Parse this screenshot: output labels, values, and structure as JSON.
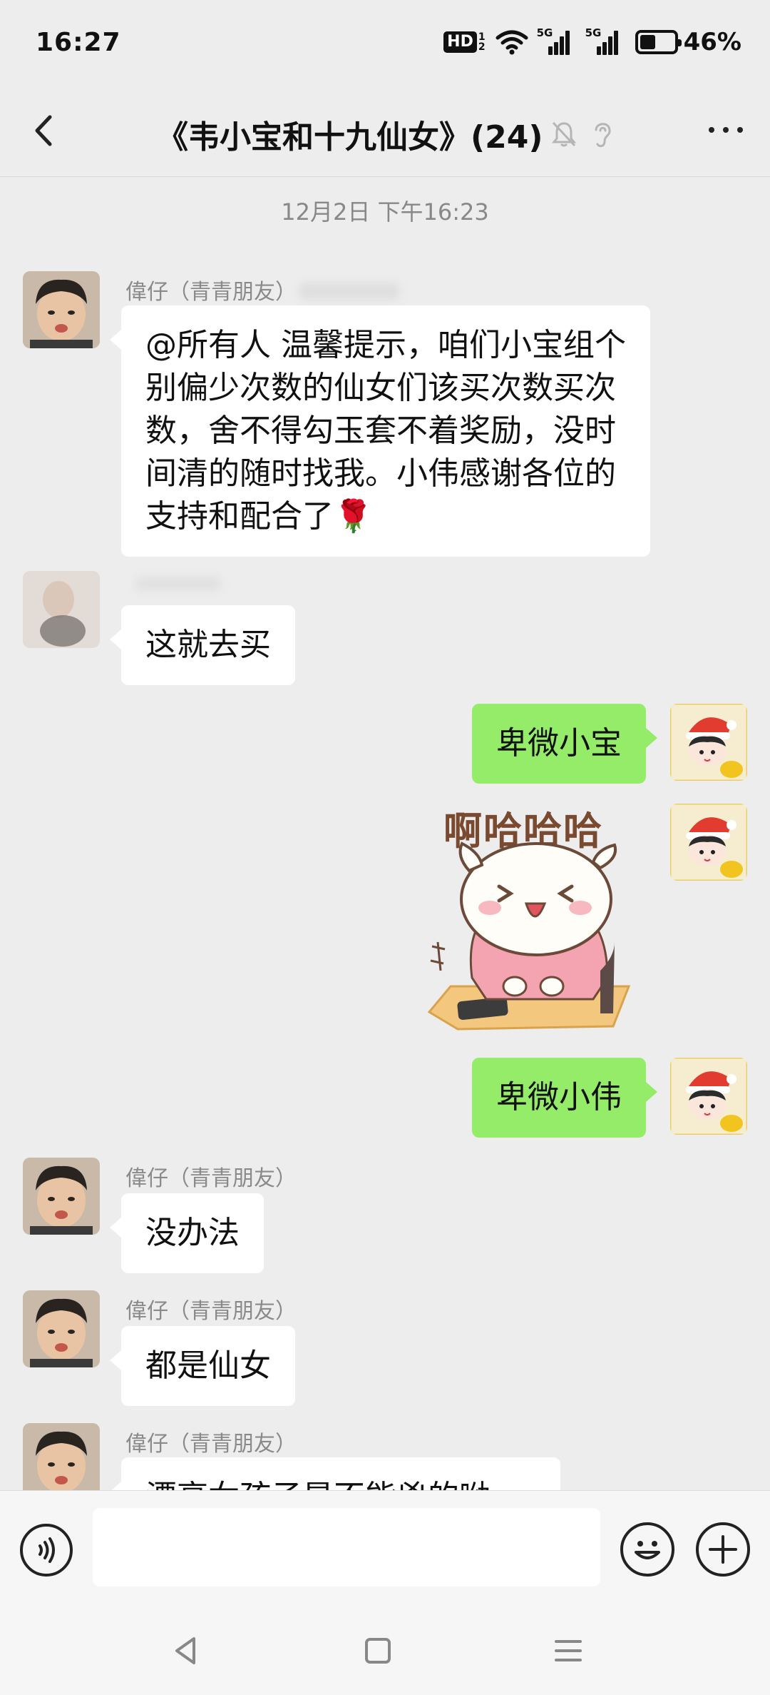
{
  "status": {
    "time": "16:27",
    "hd_label": "HD",
    "hd_sub_1": "1",
    "hd_sub_2": "2",
    "sig1_label": "5G",
    "sig2_label": "5G",
    "battery_text": "46%",
    "battery_level": 0.46
  },
  "header": {
    "title": "《韦小宝和十九仙女》(24)"
  },
  "timestamp": "12月2日 下午16:23",
  "messages": [
    {
      "sender": "偉仔（青青朋友）",
      "text": "@所有人  温馨提示，咱们小宝组个别偏少次数的仙女们该买次数买次数，舍不得勾玉套不着奖励，没时间清的随时找我。小伟感谢各位的支持和配合了🌹",
      "side": "left"
    },
    {
      "sender": "",
      "text": "这就去买",
      "side": "left"
    },
    {
      "text": "卑微小宝",
      "side": "right"
    },
    {
      "sticker_text": "啊哈哈哈",
      "side": "right"
    },
    {
      "text": "卑微小伟",
      "side": "right"
    },
    {
      "sender": "偉仔（青青朋友）",
      "text": "没办法",
      "side": "left"
    },
    {
      "sender": "偉仔（青青朋友）",
      "text": "都是仙女",
      "side": "left"
    },
    {
      "sender": "偉仔（青青朋友）",
      "text": "漂亮女孩子是不能兇的呦",
      "side": "left"
    }
  ],
  "input": {
    "placeholder": ""
  },
  "icons": {
    "back": "chevron-left-icon",
    "mute": "bell-muted-icon",
    "ear": "ear-icon",
    "more": "more-dots-icon",
    "voice": "voice-icon",
    "emoji": "emoji-icon",
    "plus": "plus-icon"
  },
  "colors": {
    "background": "#ededed",
    "self_bubble": "#95ec69",
    "other_bubble": "#ffffff"
  }
}
